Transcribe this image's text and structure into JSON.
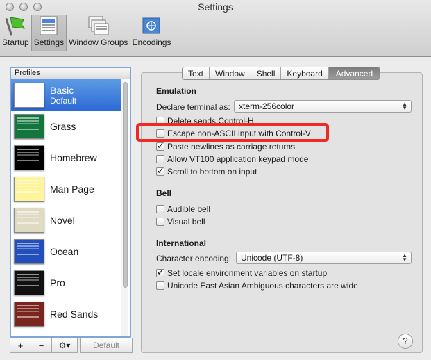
{
  "window": {
    "title": "Settings"
  },
  "toolbar": {
    "items": [
      {
        "label": "Startup",
        "icon": "startup-flag-icon",
        "active": false
      },
      {
        "label": "Settings",
        "icon": "settings-icon",
        "active": true
      },
      {
        "label": "Window Groups",
        "icon": "window-groups-icon",
        "active": false
      },
      {
        "label": "Encodings",
        "icon": "encodings-flag-icon",
        "active": false
      }
    ]
  },
  "profiles": {
    "header": "Profiles",
    "items": [
      {
        "name": "Basic",
        "sub": "Default",
        "color": "#ffffff",
        "selected": true
      },
      {
        "name": "Grass",
        "sub": "",
        "color": "#13773d",
        "selected": false
      },
      {
        "name": "Homebrew",
        "sub": "",
        "color": "#000000",
        "selected": false
      },
      {
        "name": "Man Page",
        "sub": "",
        "color": "#fef49c",
        "selected": false
      },
      {
        "name": "Novel",
        "sub": "",
        "color": "#dfdbc3",
        "selected": false
      },
      {
        "name": "Ocean",
        "sub": "",
        "color": "#224fbc",
        "selected": false
      },
      {
        "name": "Pro",
        "sub": "",
        "color": "#111111",
        "selected": false
      },
      {
        "name": "Red Sands",
        "sub": "",
        "color": "#7a251e",
        "selected": false
      }
    ],
    "buttons": {
      "add": "+",
      "remove": "−",
      "gear": "⚙▾",
      "default": "Default"
    }
  },
  "tabs": {
    "items": [
      {
        "label": "Text",
        "active": false
      },
      {
        "label": "Window",
        "active": false
      },
      {
        "label": "Shell",
        "active": false
      },
      {
        "label": "Keyboard",
        "active": false
      },
      {
        "label": "Advanced",
        "active": true
      }
    ]
  },
  "emulation": {
    "title": "Emulation",
    "declare_label": "Declare terminal as:",
    "declare_value": "xterm-256color",
    "options": [
      {
        "label": "Delete sends Control-H",
        "checked": false
      },
      {
        "label": "Escape non-ASCII input with Control-V",
        "checked": false
      },
      {
        "label": "Paste newlines as carriage returns",
        "checked": true
      },
      {
        "label": "Allow VT100 application keypad mode",
        "checked": false
      },
      {
        "label": "Scroll to bottom on input",
        "checked": true
      }
    ]
  },
  "bell": {
    "title": "Bell",
    "options": [
      {
        "label": "Audible bell",
        "checked": false
      },
      {
        "label": "Visual bell",
        "checked": false
      }
    ]
  },
  "international": {
    "title": "International",
    "encoding_label": "Character encoding:",
    "encoding_value": "Unicode (UTF-8)",
    "options": [
      {
        "label": "Set locale environment variables on startup",
        "checked": true
      },
      {
        "label": "Unicode East Asian Ambiguous characters are wide",
        "checked": false
      }
    ]
  },
  "help": {
    "label": "?"
  },
  "colors": {
    "highlight": "#ee2a24",
    "selection": "#3a78dd"
  }
}
